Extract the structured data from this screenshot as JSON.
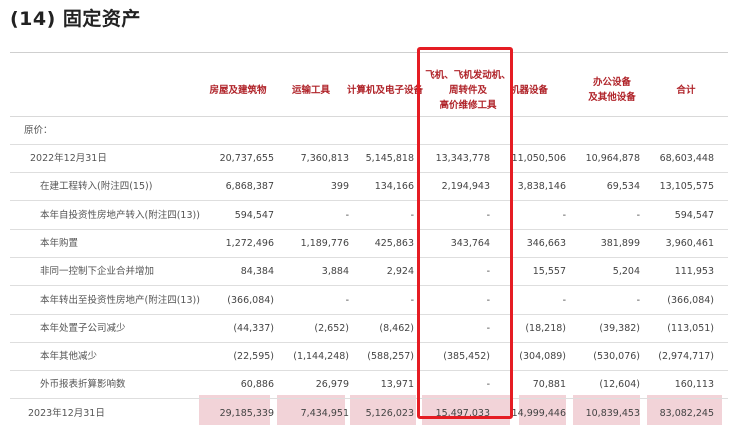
{
  "title": "(14) 固定资产",
  "columns": [
    [
      "房屋及建筑物"
    ],
    [
      "运输工具"
    ],
    [
      "计算机及电子设备"
    ],
    [
      "飞机、飞机发动机、",
      "周转件及",
      "高价维修工具"
    ],
    [
      "机器设备"
    ],
    [
      "办公设备",
      "及其他设备"
    ],
    [
      "合计"
    ]
  ],
  "section_label": "原价：",
  "rows": [
    {
      "label": "2022年12月31日",
      "values": [
        "20,737,655",
        "7,360,813",
        "5,145,818",
        "13,343,778",
        "11,050,506",
        "10,964,878",
        "68,603,448"
      ]
    },
    {
      "label": "在建工程转入(附注四(15))",
      "values": [
        "6,868,387",
        "399",
        "134,166",
        "2,194,943",
        "3,838,146",
        "69,534",
        "13,105,575"
      ]
    },
    {
      "label": "本年自投资性房地产转入(附注四(13))",
      "values": [
        "594,547",
        "-",
        "-",
        "-",
        "-",
        "-",
        "594,547"
      ]
    },
    {
      "label": "本年购置",
      "values": [
        "1,272,496",
        "1,189,776",
        "425,863",
        "343,764",
        "346,663",
        "381,899",
        "3,960,461"
      ]
    },
    {
      "label": "非同一控制下企业合并增加",
      "values": [
        "84,384",
        "3,884",
        "2,924",
        "-",
        "15,557",
        "5,204",
        "111,953"
      ]
    },
    {
      "label": "本年转出至投资性房地产(附注四(13))",
      "values": [
        "(366,084)",
        "-",
        "-",
        "-",
        "-",
        "-",
        "(366,084)"
      ]
    },
    {
      "label": "本年处置子公司减少",
      "values": [
        "(44,337)",
        "(2,652)",
        "(8,462)",
        "-",
        "(18,218)",
        "(39,382)",
        "(113,051)"
      ]
    },
    {
      "label": "本年其他减少",
      "values": [
        "(22,595)",
        "(1,144,248)",
        "(588,257)",
        "(385,452)",
        "(304,089)",
        "(530,076)",
        "(2,974,717)"
      ]
    },
    {
      "label": "外币报表折算影响数",
      "values": [
        "60,886",
        "26,979",
        "13,971",
        "-",
        "70,881",
        "(12,604)",
        "160,113"
      ]
    },
    {
      "label": "2023年12月31日",
      "values": [
        "29,185,339",
        "7,434,951",
        "5,126,023",
        "15,497,033",
        "14,999,446",
        "10,839,453",
        "83,082,245"
      ]
    }
  ],
  "colors": {
    "header_text": "#b0242a",
    "total_row_bg": "#f2d3d8",
    "highlight_box": "#e51c23"
  }
}
